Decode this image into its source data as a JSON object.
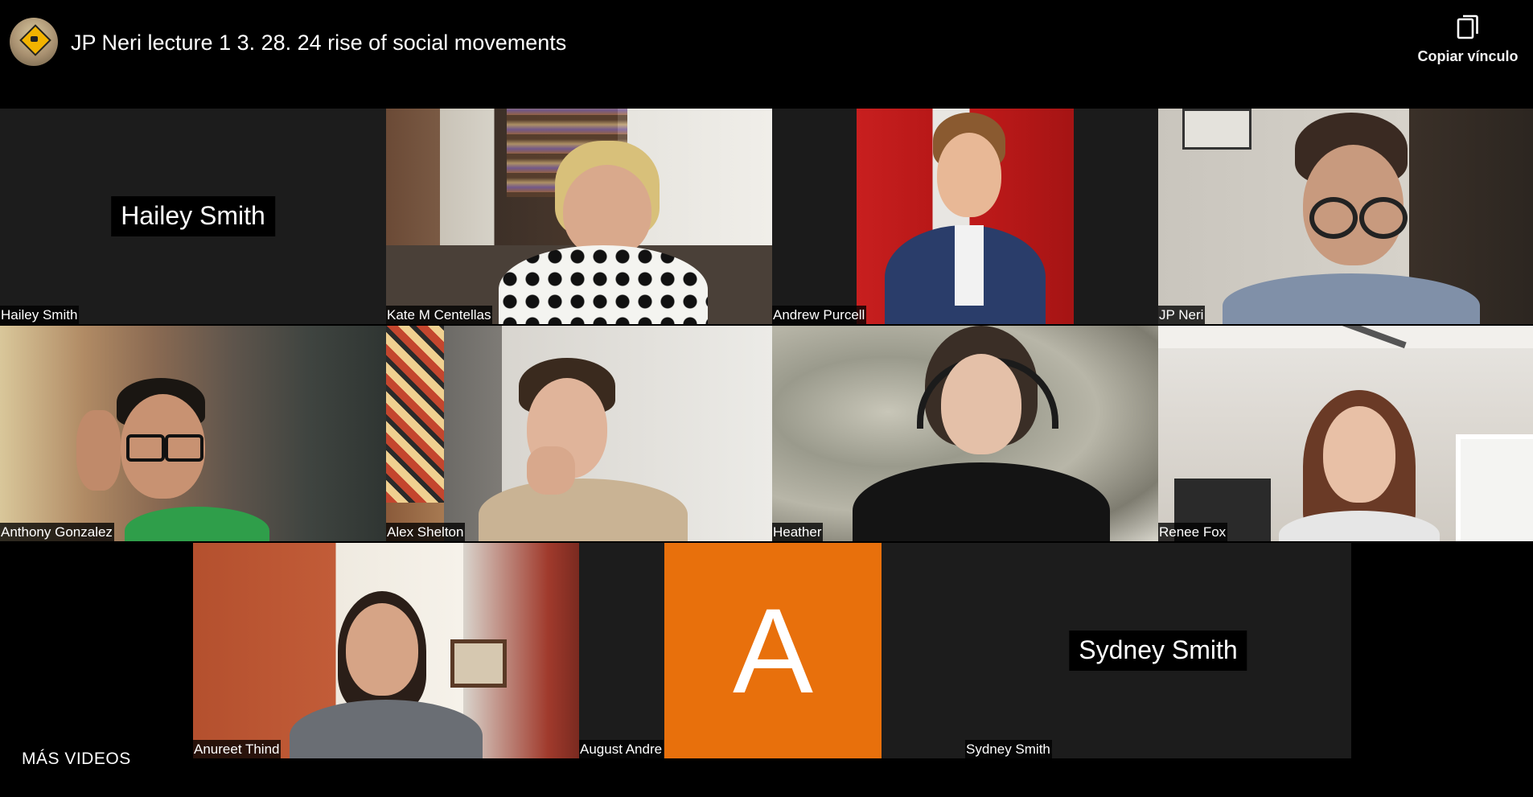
{
  "header": {
    "title": "JP Neri lecture 1 3. 28. 24 rise of social movements",
    "channel_avatar_icon": "channel-avatar",
    "copy_link_label": "Copiar vínculo",
    "copy_icon": "copy-icon"
  },
  "participants": [
    {
      "name": "Hailey Smith",
      "video": false
    },
    {
      "name": "Kate M Centellas",
      "video": true
    },
    {
      "name": "Andrew Purcell",
      "video": true
    },
    {
      "name": "JP Neri",
      "video": true
    },
    {
      "name": "Anthony Gonzalez",
      "video": true
    },
    {
      "name": "Alex Shelton",
      "video": true
    },
    {
      "name": "Heather",
      "video": true
    },
    {
      "name": "Renee Fox",
      "video": true
    },
    {
      "name": "Anureet Thind",
      "video": true
    },
    {
      "name": "August Andre",
      "video": false,
      "initial": "A"
    },
    {
      "name": "Sydney Smith",
      "video": false
    }
  ],
  "footer": {
    "more_videos_label": "MÁS VIDEOS"
  },
  "colors": {
    "background": "#000000",
    "tile": "#1a1a1a",
    "avatar_orange": "#e8700c"
  }
}
